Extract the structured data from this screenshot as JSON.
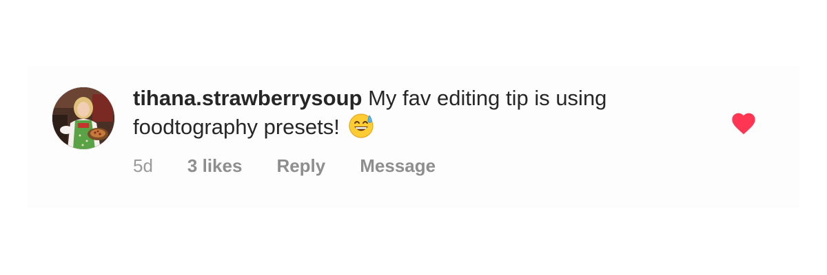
{
  "comment": {
    "username": "tihana.strawberrysoup",
    "text": " My fav editing tip is using foodtography presets!",
    "emoji": "grinning-face-with-sweat-emoji"
  },
  "meta": {
    "time": "5d",
    "likes": "3 likes",
    "reply_label": "Reply",
    "message_label": "Message"
  },
  "like": {
    "icon": "heart-icon",
    "liked": true,
    "color": "#fe3553"
  },
  "colors": {
    "text": "#262626",
    "secondary": "#8e8e8e",
    "background": "#fdfdfd"
  }
}
